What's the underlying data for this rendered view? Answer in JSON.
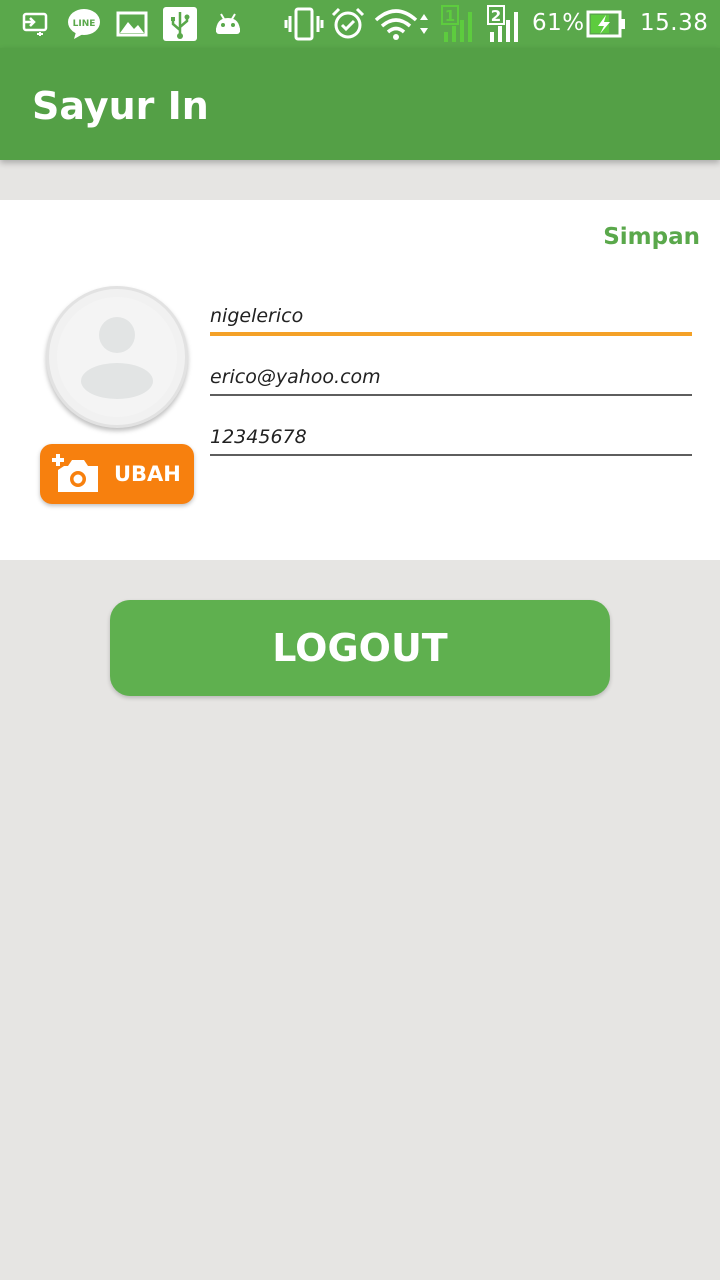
{
  "status_bar": {
    "battery": "61%",
    "time": "15.38",
    "sim1": "1",
    "sim2": "2",
    "icons": [
      "screen-cast-icon",
      "line-app-icon",
      "gallery-icon",
      "usb-icon",
      "android-debug-icon",
      "vibrate-icon",
      "alarm-icon",
      "wifi-icon",
      "signal-icon",
      "battery-charging-icon"
    ],
    "line_label": "LINE"
  },
  "app_bar": {
    "title": "Sayur In"
  },
  "profile": {
    "save_label": "Simpan",
    "change_photo_label": "UBAH",
    "username": "nigelerico",
    "email": "erico@yahoo.com",
    "phone": "12345678"
  },
  "logout_label": "LOGOUT",
  "colors": {
    "status_bar": "#5aa84b",
    "app_bar": "#54a046",
    "accent_green": "#5aa84b",
    "orange": "#f7800e",
    "focus_underline": "#f4a127",
    "background": "#e6e5e3"
  }
}
